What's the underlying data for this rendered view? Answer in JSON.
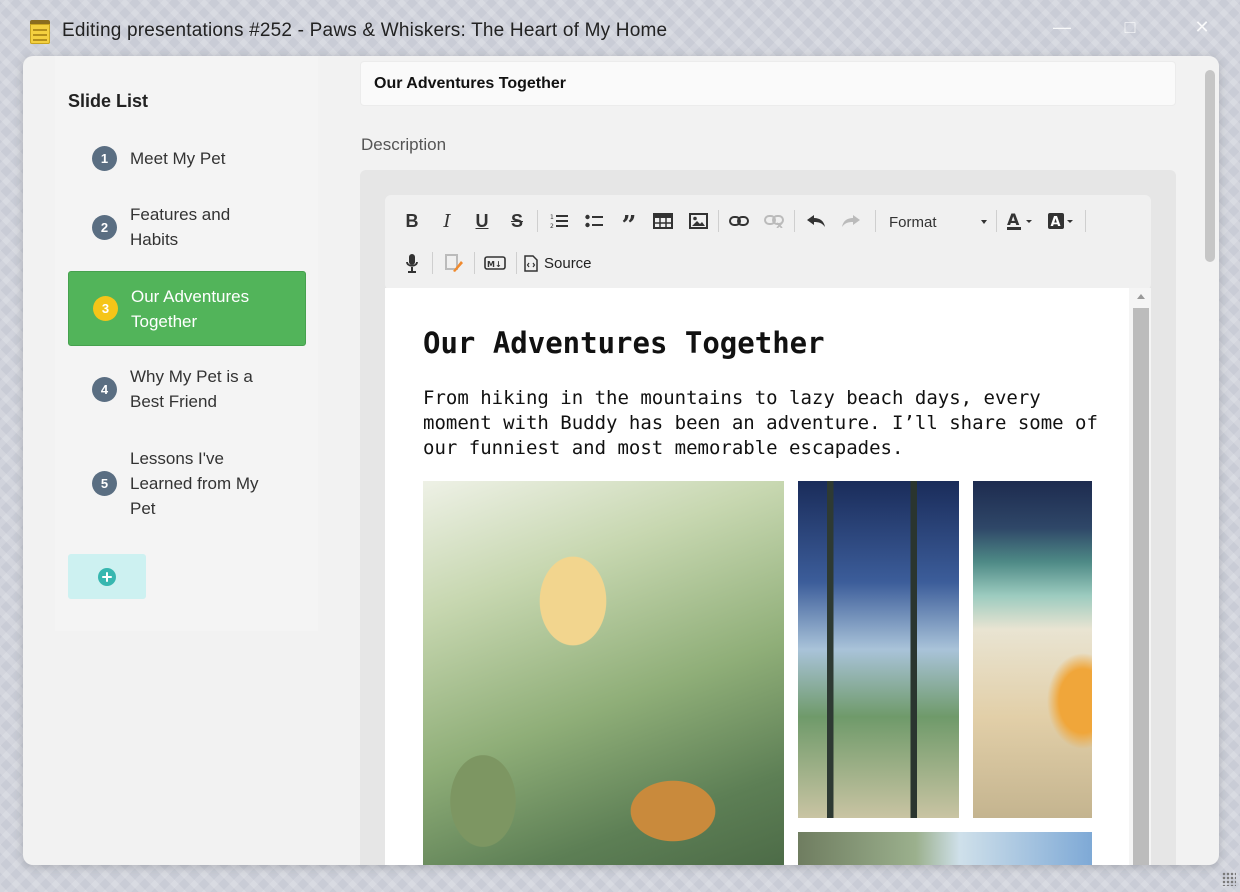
{
  "window": {
    "title": "Editing presentations #252 - Paws & Whiskers: The Heart of My Home"
  },
  "sidebar": {
    "heading": "Slide List",
    "items": [
      {
        "number": "1",
        "label": "Meet My Pet"
      },
      {
        "number": "2",
        "label": "Features and Habits"
      },
      {
        "number": "3",
        "label": "Our Adventures Together"
      },
      {
        "number": "4",
        "label": "Why My Pet is a Best Friend"
      },
      {
        "number": "5",
        "label": "Lessons I've Learned from My Pet"
      }
    ],
    "active_index": 2
  },
  "editor": {
    "title_value": "Our Adventures Together",
    "description_label": "Description",
    "toolbar": {
      "format_label": "Format",
      "source_label": "Source"
    },
    "content": {
      "heading": "Our Adventures Together",
      "paragraph": "From hiking in the mountains to lazy beach days, every moment with Buddy has been an adventure. I’ll share some of our funniest and most memorable escapades."
    }
  },
  "colors": {
    "active_slide": "#52b45a",
    "active_badge": "#f5c518",
    "badge": "#5a6e82",
    "add_button": "#cdf1f1",
    "add_icon": "#37b7b0"
  }
}
